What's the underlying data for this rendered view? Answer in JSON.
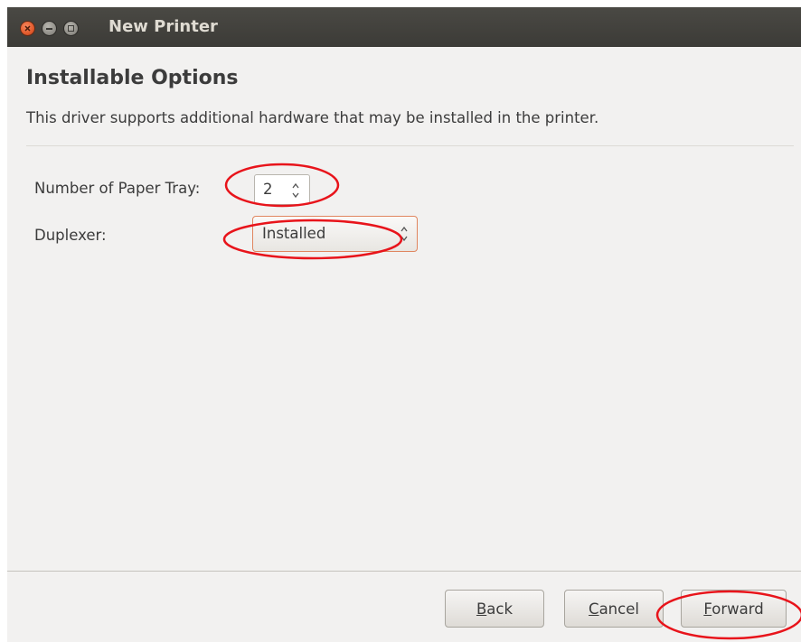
{
  "window": {
    "title": "New Printer"
  },
  "page": {
    "heading": "Installable Options",
    "description": "This driver supports additional hardware that may be installed in the printer."
  },
  "options": {
    "paper_tray": {
      "label": "Number of Paper Tray:",
      "value": "2"
    },
    "duplexer": {
      "label": "Duplexer:",
      "value": "Installed"
    }
  },
  "buttons": {
    "back": {
      "mnemonic": "B",
      "rest": "ack"
    },
    "cancel": {
      "mnemonic": "C",
      "rest": "ancel"
    },
    "forward": {
      "mnemonic": "F",
      "rest": "orward"
    }
  },
  "annotation_color": "#e8141b"
}
